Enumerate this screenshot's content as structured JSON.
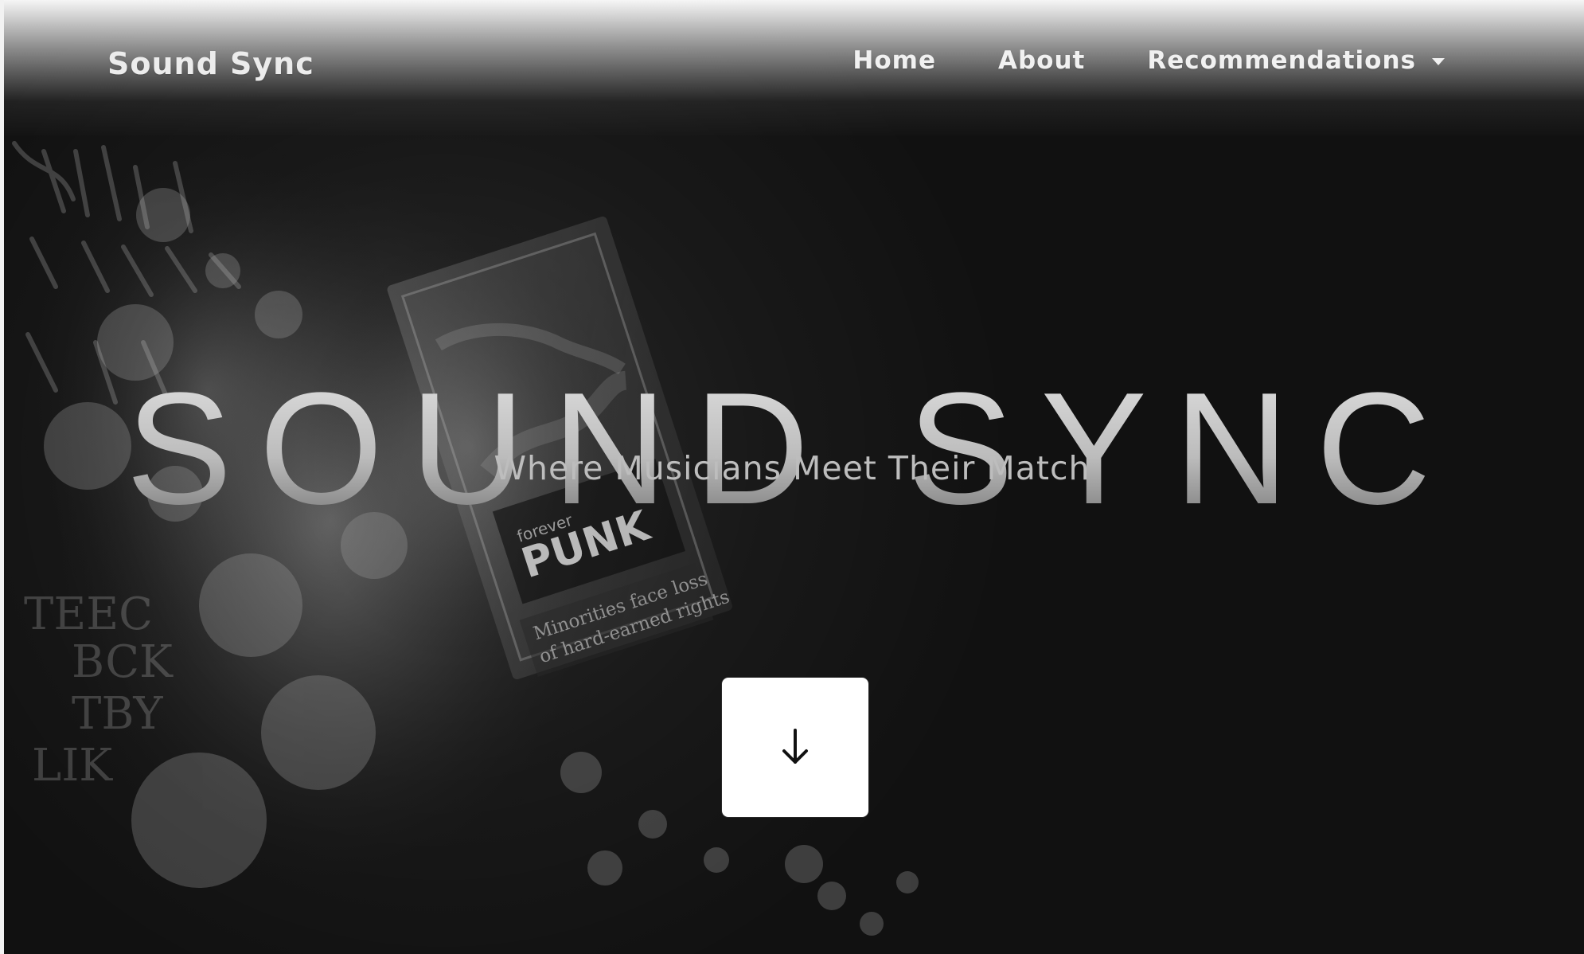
{
  "navbar": {
    "brand": "Sound Sync",
    "links": [
      {
        "label": "Home"
      },
      {
        "label": "About"
      },
      {
        "label": "Recommendations"
      }
    ]
  },
  "hero": {
    "title": "SOUND SYNC",
    "subtitle": "Where Musicians Meet Their Match"
  },
  "artwork": {
    "visible_text": [
      "forever PUNK",
      "Minorities face loss",
      "of hard-earned rights"
    ]
  },
  "icons": {
    "scroll_icon": "arrow-down-icon",
    "dropdown_icon": "caret-down-icon"
  },
  "colors": {
    "background": "#111111",
    "text_light": "#ececec",
    "subtitle": "#bdbdbd",
    "button_bg": "#ffffff",
    "button_icon": "#111111"
  }
}
